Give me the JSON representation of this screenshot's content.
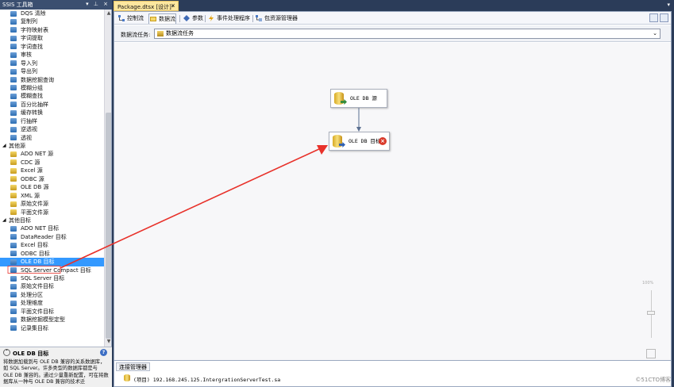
{
  "toolbox": {
    "title": "SSIS 工具箱",
    "title_buttons": "▾ ⊥ ×",
    "items_top": [
      "DQS 清除",
      "复制列",
      "字符映射表",
      "字词提取",
      "字词查找",
      "审核",
      "导入列",
      "导出列",
      "数据挖掘查询",
      "模糊分组",
      "模糊查找",
      "百分比抽样",
      "缓存转换",
      "行抽样",
      "逆透视",
      "透视"
    ],
    "group_other_sources": "其他源",
    "other_sources": [
      "ADO NET 源",
      "CDC 源",
      "Excel 源",
      "ODBC 源",
      "OLE DB 源",
      "XML 源",
      "原始文件源",
      "平面文件源"
    ],
    "group_other_destinations": "其他目标",
    "other_destinations": [
      "ADO NET 目标",
      "DataReader 目标",
      "Excel 目标",
      "ODBC 目标",
      "OLE DB 目标",
      "SQL Server Compact 目标",
      "SQL Server 目标",
      "原始文件目标",
      "处理分区",
      "处理维度",
      "平面文件目标",
      "数据挖掘模型定型",
      "记录集目标"
    ],
    "selected_item": "OLE DB 目标"
  },
  "description": {
    "title": "OLE DB 目标",
    "text": "将数据加载到与 OLE DB 兼容的关系数据库，如 SQL Server。许多类型的数据库都是与 OLE DB 兼容的。通过少量重新配置，可在将数据库从一种与 OLE DB 兼容的技术迁"
  },
  "document": {
    "tab_title": "Package.dtsx [设计]*",
    "close_glyph": "×"
  },
  "designer_tabs": [
    "控制流",
    "数据流",
    "参数",
    "事件处理程序",
    "包资源管理器"
  ],
  "active_tab": "数据流",
  "data_flow_task": {
    "label": "数据流任务:",
    "selected": "数据流任务"
  },
  "nodes": {
    "source": "OLE DB 源",
    "destination": "OLE DB 目标",
    "error_glyph": "×"
  },
  "zoom": {
    "percent": "100%"
  },
  "connection_managers": {
    "tab": "连接管理器",
    "item": "(项目) 192.168.245.125.IntergrationServerTest.sa"
  },
  "watermark": "©51CTO博客",
  "colors": {
    "accent_selected": "#3399ff",
    "frame": "#2b3c59",
    "annotation_arrow": "#e8312a",
    "document_tab": "#fde79f"
  }
}
